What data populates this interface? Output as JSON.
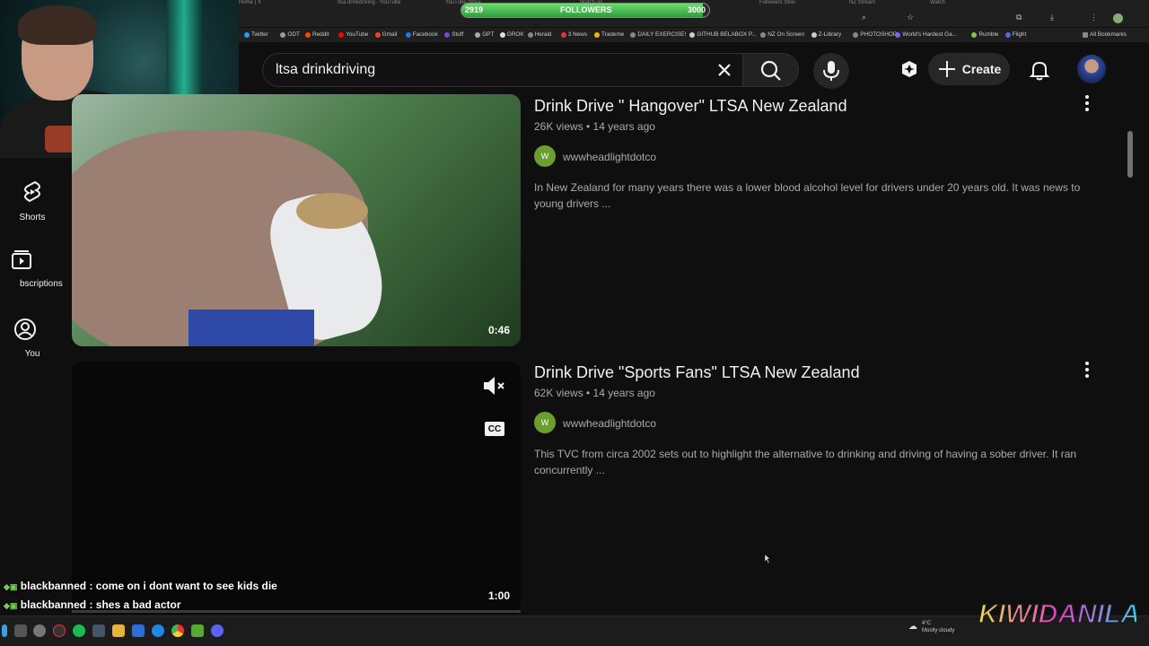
{
  "browser": {
    "tabs": [
      "Home | X",
      "ltsa drinkdriving - YouTube",
      "YouTube Stream",
      "Watch on",
      "Kiwidanila",
      "Followers Stream",
      "NZ Stream",
      "Watch"
    ],
    "followers_goal": {
      "label": "FOLLOWERS",
      "current": "2919",
      "target": "3000",
      "fraction": 0.973
    },
    "bookmarks": [
      "Twitter",
      "ODT",
      "Reddit",
      "YouTube",
      "Gmail",
      "Facebook",
      "Stuff",
      "GPT",
      "GROK",
      "Herald",
      "3 News",
      "Trademe",
      "DAILY EXERCISE!",
      "GITHUB BELABOX P...",
      "NZ On Screen",
      "Z-Library",
      "PHOTOSHOP",
      "World's Hardest Ga...",
      "Rumble",
      "Flight"
    ],
    "all_bookmarks": "All Bookmarks"
  },
  "sidebar": {
    "items": [
      {
        "label": "Shorts",
        "icon": "shorts-icon"
      },
      {
        "label": "bscriptions",
        "icon": "subscriptions-icon"
      },
      {
        "label": "You",
        "icon": "you-icon"
      }
    ]
  },
  "masthead": {
    "search_query": "ltsa drinkdriving",
    "create_label": "Create"
  },
  "results": [
    {
      "title": "Drink Drive \" Hangover\" LTSA New Zealand",
      "meta": "26K views • 14 years ago",
      "channel": "wwwheadlightdotco",
      "channel_initial": "W",
      "description": "In New Zealand for many years there was a lower blood alcohol level for drivers under 20 years old. It was news to young drivers ...",
      "duration": "0:46"
    },
    {
      "title": "Drink Drive \"Sports Fans\" LTSA New Zealand",
      "meta": "62K views • 14 years ago",
      "channel": "wwwheadlightdotco",
      "channel_initial": "W",
      "description": "This TVC from circa 2002 sets out to highlight the alternative to drinking and driving of having a sober driver. It ran concurrently ...",
      "duration": "1:00",
      "cc_label": "CC"
    }
  ],
  "chat": [
    "blackbanned : come on i dont want to see kids die",
    "blackbanned : shes a bad actor"
  ],
  "taskbar": {
    "weather_temp": "4°C",
    "weather_desc": "Mostly cloudy"
  },
  "logo_text": "KIWIDANILA",
  "colors": {
    "accent": "#3ea6ff",
    "channel_avatar": "#6a9e2e",
    "followers_fill": "#4fc45a"
  }
}
